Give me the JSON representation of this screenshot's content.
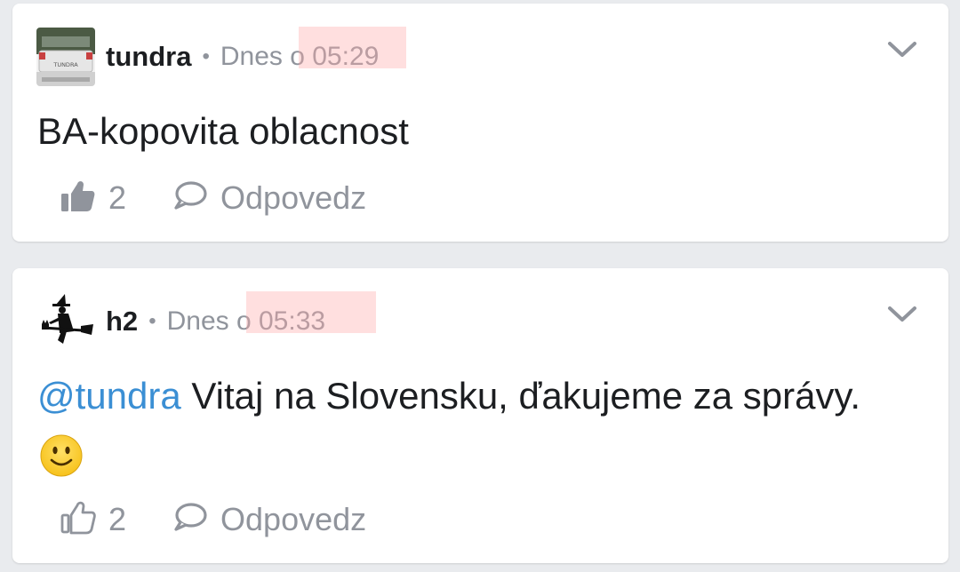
{
  "comments": [
    {
      "author": "tundra",
      "separator": "•",
      "time_prefix": "Dnes o",
      "time": "05:29",
      "text": "BA-kopovita oblacnost",
      "likes": "2",
      "liked": true,
      "reply_label": "Odpovedz",
      "avatar_plate_text": "TUNDRA"
    },
    {
      "author": "h2",
      "separator": "•",
      "time_prefix": "Dnes o",
      "time": "05:33",
      "mention": "@tundra",
      "text": "Vitaj na Slovensku, ďakujeme za správy.",
      "likes": "2",
      "liked": false,
      "reply_label": "Odpovedz"
    }
  ],
  "colors": {
    "background": "#e9ebee",
    "card": "#ffffff",
    "meta_gray": "#90949c",
    "mention_blue": "#3b8fd4",
    "redaction": "#ffb3b3"
  },
  "icons": [
    "avatar-truck",
    "avatar-witch",
    "chevron-down-icon",
    "thumbs-up-icon",
    "comment-bubble-icon",
    "smiley-emoji"
  ]
}
